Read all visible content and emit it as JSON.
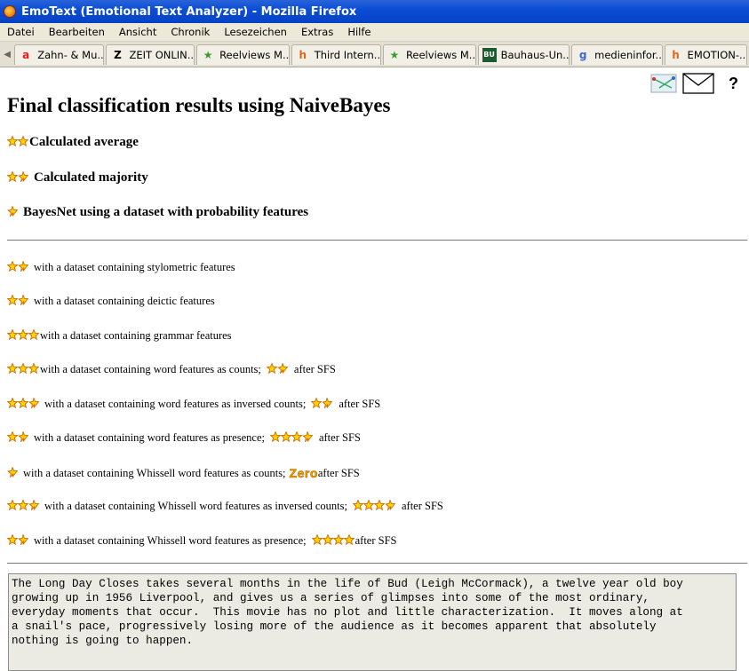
{
  "window": {
    "title": "EmoText (Emotional Text Analyzer) - Mozilla Firefox"
  },
  "menu": [
    "Datei",
    "Bearbeiten",
    "Ansicht",
    "Chronik",
    "Lesezeichen",
    "Extras",
    "Hilfe"
  ],
  "tabs": [
    {
      "label": "Zahn- & Mu...",
      "icon": "amazon-a-icon",
      "glyph": "a",
      "color": "#e31d1d"
    },
    {
      "label": "ZEIT ONLIN...",
      "icon": "zeit-z-icon",
      "glyph": "Z",
      "color": "#000000"
    },
    {
      "label": "Reelviews M...",
      "icon": "green-star-icon",
      "glyph": "★",
      "color": "#3c9a2c"
    },
    {
      "label": "Third Intern...",
      "icon": "h-icon",
      "glyph": "h",
      "color": "#e0661b"
    },
    {
      "label": "Reelviews M...",
      "icon": "green-star-icon",
      "glyph": "★",
      "color": "#3c9a2c"
    },
    {
      "label": "Bauhaus-Un...",
      "icon": "buw-icon",
      "glyph": "BU",
      "color": "#1d5a2f"
    },
    {
      "label": "medieninfor...",
      "icon": "google-g-icon",
      "glyph": "g",
      "color": "#3b6ad8"
    },
    {
      "label": "EMOTION-...",
      "icon": "h-icon",
      "glyph": "h",
      "color": "#e0661b"
    }
  ],
  "page": {
    "heading": "Final classification results using NaiveBayes",
    "help": "?",
    "summary": [
      {
        "stars": 2.0,
        "label": "Calculated average"
      },
      {
        "stars": 1.5,
        "label": "Calculated majority"
      },
      {
        "stars": 0.5,
        "label": "BayesNet using a dataset with probability features"
      }
    ],
    "details": [
      {
        "stars": 1.5,
        "label": "with a dataset containing stylometric features"
      },
      {
        "stars": 1.5,
        "label": "with a dataset containing deictic features"
      },
      {
        "stars": 3.0,
        "label": "with a dataset containing grammar features"
      },
      {
        "stars": 3.0,
        "label": "with a dataset containing word features as counts;",
        "sfs_stars": 1.5,
        "sfs_label": "after SFS"
      },
      {
        "stars": 2.5,
        "label": "with a dataset containing word features as inversed counts;",
        "sfs_stars": 1.5,
        "sfs_label": "after SFS"
      },
      {
        "stars": 1.5,
        "label": "with a dataset containing word features as presence;",
        "sfs_stars": 3.5,
        "sfs_label": "after SFS"
      },
      {
        "stars": 0.5,
        "label": "with a dataset containing Whissell word features as counts;",
        "sfs_text": "Zero",
        "sfs_label": "after SFS"
      },
      {
        "stars": 2.5,
        "label": "with a dataset containing Whissell word features as inversed counts;",
        "sfs_stars": 3.5,
        "sfs_label": "after SFS"
      },
      {
        "stars": 1.5,
        "label": "with a dataset containing Whissell word features as presence;",
        "sfs_stars": 4.0,
        "sfs_label": "after SFS"
      }
    ],
    "review_text": "The Long Day Closes takes several months in the life of Bud (Leigh McCormack), a twelve year old boy\ngrowing up in 1956 Liverpool, and gives us a series of glimpses into some of the most ordinary,\neveryday moments that occur.  This movie has no plot and little characterization.  It moves along at\na snail's pace, progressively losing more of the audience as it becomes apparent that absolutely\nnothing is going to happen."
  },
  "colors": {
    "star_fill": "#ffd400",
    "star_stroke": "#d06a00"
  }
}
